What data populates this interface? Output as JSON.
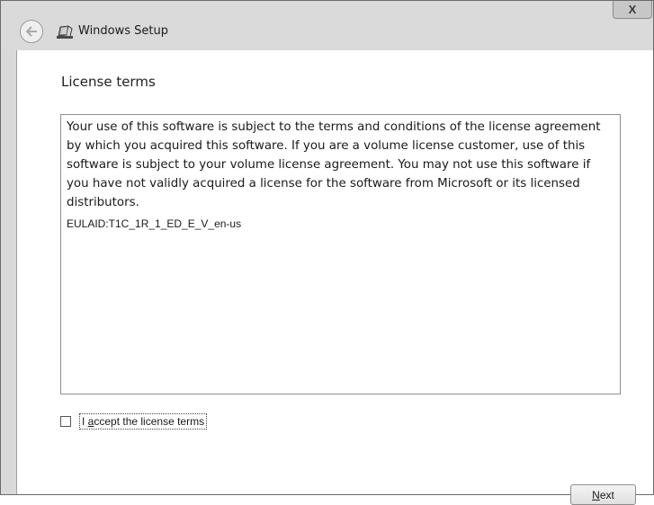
{
  "window": {
    "title": "Windows Setup",
    "close_label": "X"
  },
  "page": {
    "heading": "License terms"
  },
  "license": {
    "body": "Your use of this software is subject to the terms and conditions of the license agreement by which you acquired this software.  If you are a volume license customer, use of this software is subject to your volume license agreement.  You may not use this software if you have not validly acquired a license for the software from Microsoft or its licensed distributors.",
    "eula_id": "EULAID:T1C_1R_1_ED_E_V_en-us"
  },
  "accept": {
    "label_prefix": "I ",
    "label_underlined": "a",
    "label_rest": "ccept the license terms",
    "checked": false
  },
  "buttons": {
    "next_underlined": "N",
    "next_rest": "ext"
  },
  "icons": {
    "back": "back-arrow-icon",
    "app": "windows-setup-icon",
    "close": "close-icon"
  }
}
